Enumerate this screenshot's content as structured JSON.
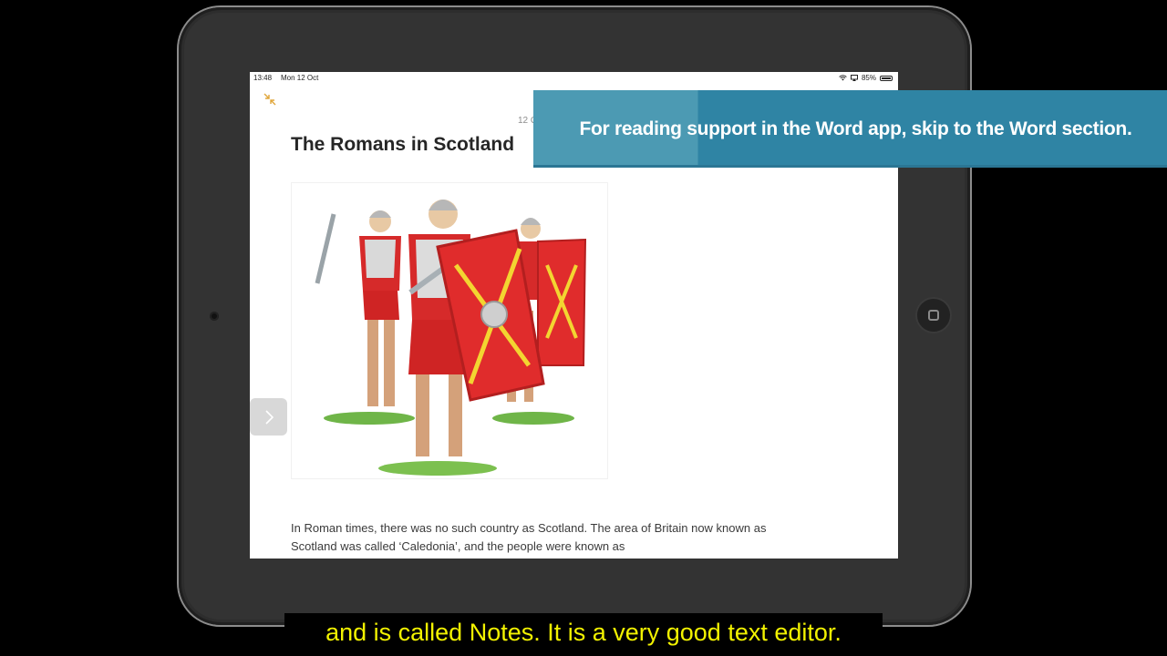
{
  "status_bar": {
    "time": "13:48",
    "date": "Mon 12 Oct",
    "battery": "85%",
    "battery_level": 0.85
  },
  "note": {
    "date_partial": "12 O",
    "title": "The Romans in Scotland",
    "body": "In Roman times, there was no such country as Scotland. The area of Britain now known as Scotland was called ‘Caledonia’, and the people were known as"
  },
  "banner": {
    "text": "For reading support in the Word app, skip to the Word section."
  },
  "caption": {
    "text": "and is called Notes. It is a very good text editor."
  },
  "icons": {
    "collapse": "collapse-arrows-icon",
    "next": "chevron-right-icon",
    "wifi": "wifi-icon",
    "screen_mirror": "airplay-icon",
    "battery": "battery-icon"
  },
  "colors": {
    "banner_left": "#4c9ab3",
    "banner_right": "#2f84a4",
    "caption_text": "#f2f200",
    "accent_collapse": "#e0a63a"
  }
}
